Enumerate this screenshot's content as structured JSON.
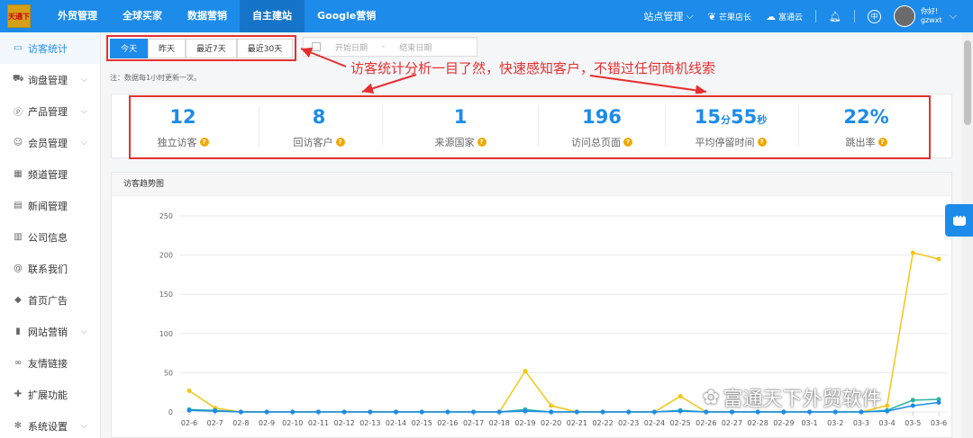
{
  "logo": {
    "text": "天通下"
  },
  "topnav": [
    "外贸管理",
    "全球买家",
    "数据营销",
    "自主建站",
    "Google营销"
  ],
  "topnav_active": 3,
  "top_right": {
    "site_manage": "站点管理",
    "mango_store": "芒果店长",
    "futong_cloud": "富通云",
    "greeting": "你好!",
    "username": "gzwxt"
  },
  "sidebar": [
    {
      "label": "访客统计",
      "icon": "monitor-icon",
      "chevron": false,
      "active": true
    },
    {
      "label": "询盘管理",
      "icon": "cart-icon",
      "chevron": true
    },
    {
      "label": "产品管理",
      "icon": "product-icon",
      "chevron": true
    },
    {
      "label": "会员管理",
      "icon": "users-icon",
      "chevron": true
    },
    {
      "label": "频道管理",
      "icon": "grid-icon",
      "chevron": false
    },
    {
      "label": "新闻管理",
      "icon": "news-icon",
      "chevron": false
    },
    {
      "label": "公司信息",
      "icon": "building-icon",
      "chevron": false
    },
    {
      "label": "联系我们",
      "icon": "at-icon",
      "chevron": false
    },
    {
      "label": "首页广告",
      "icon": "cube-icon",
      "chevron": false
    },
    {
      "label": "网站营销",
      "icon": "chart-icon",
      "chevron": true
    },
    {
      "label": "友情链接",
      "icon": "link-icon",
      "chevron": false
    },
    {
      "label": "扩展功能",
      "icon": "puzzle-icon",
      "chevron": false
    },
    {
      "label": "系统设置",
      "icon": "gear-icon",
      "chevron": true
    }
  ],
  "tabs": [
    "今天",
    "昨天",
    "最近7天",
    "最近30天"
  ],
  "tab_active": 0,
  "date_range": {
    "start_placeholder": "开始日期",
    "separator": "-",
    "end_placeholder": "结束日期"
  },
  "annotation": "访客统计分析一目了然，快速感知客户，不错过任何商机线索",
  "note": "注：数据每1小时更新一次。",
  "stats": [
    {
      "value": "12",
      "label": "独立访客"
    },
    {
      "value": "8",
      "label": "回访客户"
    },
    {
      "value": "1",
      "label": "来源国家"
    },
    {
      "value": "196",
      "label": "访问总页面"
    },
    {
      "value_main": "15",
      "unit1": "分",
      "value_sec": "55",
      "unit2": "秒",
      "label": "平均停留时间"
    },
    {
      "value": "22%",
      "label": "跳出率"
    }
  ],
  "chart_title": "访客趋势图",
  "chart_data": {
    "type": "line",
    "categories": [
      "02-6",
      "02-7",
      "02-8",
      "02-9",
      "02-10",
      "02-11",
      "02-12",
      "02-13",
      "02-14",
      "02-15",
      "02-16",
      "02-17",
      "02-18",
      "02-19",
      "02-20",
      "02-21",
      "02-22",
      "02-23",
      "02-24",
      "02-25",
      "02-26",
      "02-27",
      "02-28",
      "02-29",
      "03-1",
      "03-2",
      "03-3",
      "03-4",
      "03-5",
      "03-6"
    ],
    "yticks": [
      0,
      50,
      100,
      150,
      200,
      250
    ],
    "ylim": [
      0,
      250
    ],
    "grid": true,
    "series": [
      {
        "color": "#f5c518",
        "values": [
          27,
          5,
          0,
          0,
          0,
          0,
          0,
          0,
          0,
          0,
          0,
          0,
          0,
          52,
          8,
          0,
          0,
          0,
          0,
          20,
          0,
          0,
          0,
          0,
          0,
          0,
          0,
          8,
          203,
          195
        ]
      },
      {
        "color": "#2bb3a0",
        "values": [
          3,
          2,
          0,
          0,
          0,
          0,
          0,
          0,
          0,
          0,
          0,
          0,
          0,
          3,
          0,
          0,
          0,
          0,
          0,
          2,
          0,
          0,
          0,
          0,
          0,
          0,
          0,
          2,
          15,
          16
        ]
      },
      {
        "color": "#1c8bea",
        "values": [
          2,
          1,
          0,
          0,
          0,
          0,
          0,
          0,
          0,
          0,
          0,
          0,
          0,
          1,
          0,
          0,
          0,
          0,
          0,
          1,
          0,
          0,
          0,
          0,
          0,
          0,
          0,
          1,
          8,
          12
        ]
      }
    ]
  },
  "watermark": "富通天下外贸软件"
}
